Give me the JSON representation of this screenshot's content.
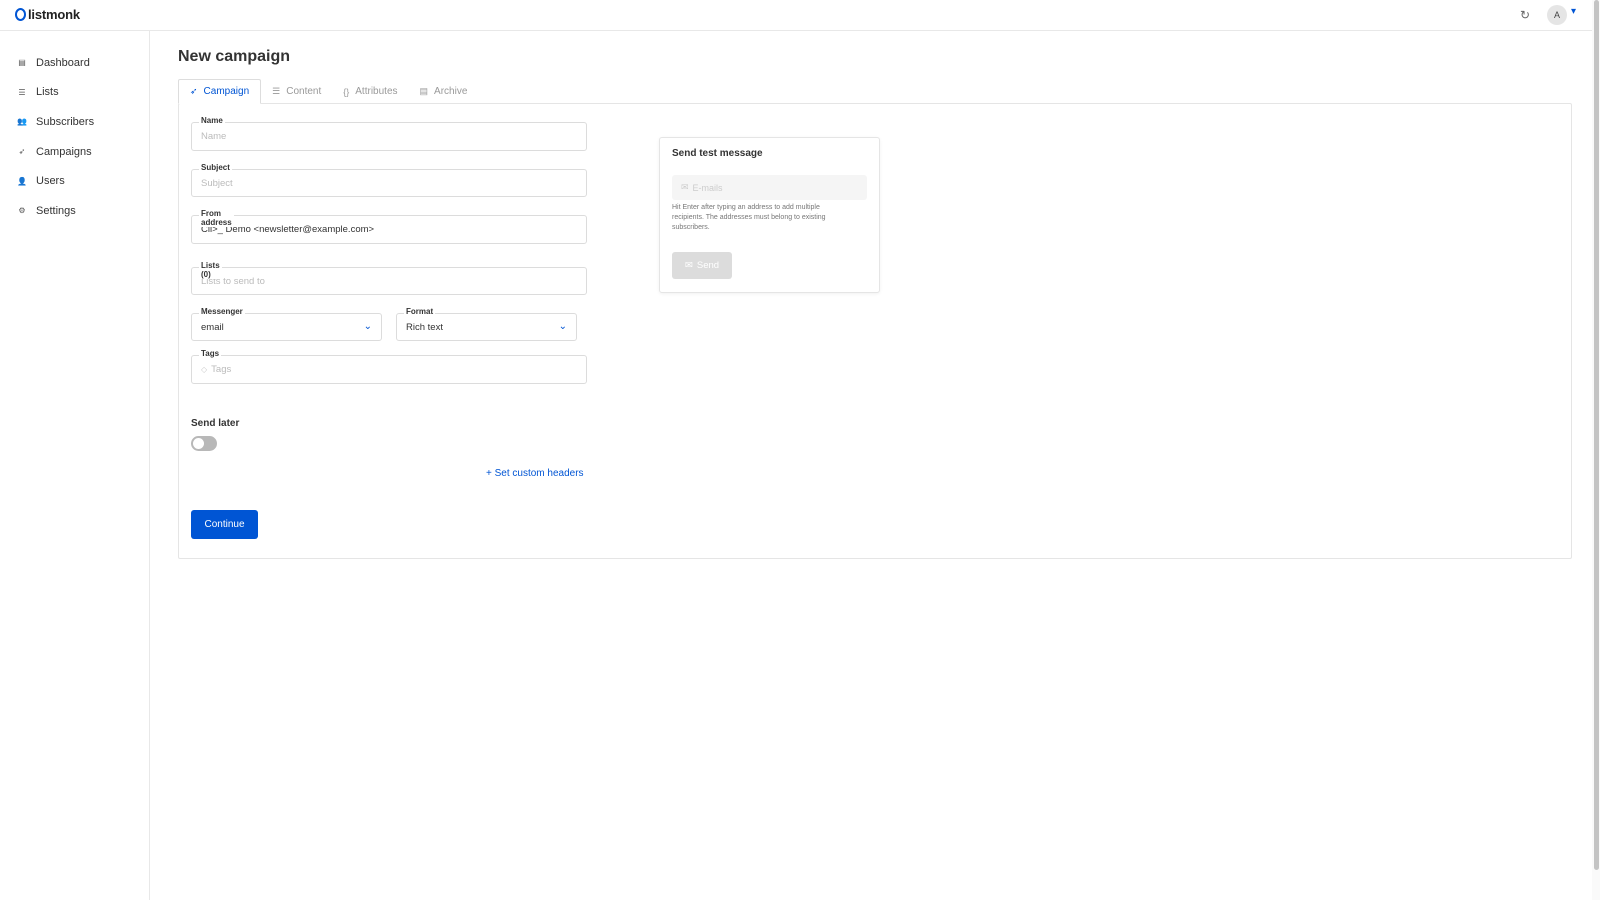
{
  "app": {
    "logo_text": "listmonk"
  },
  "header": {
    "avatar_initial": "A"
  },
  "sidebar": {
    "items": [
      {
        "label": "Dashboard",
        "icon": "dashboard-icon"
      },
      {
        "label": "Lists",
        "icon": "list-icon"
      },
      {
        "label": "Subscribers",
        "icon": "users-icon"
      },
      {
        "label": "Campaigns",
        "icon": "rocket-icon"
      },
      {
        "label": "Users",
        "icon": "user-icon"
      },
      {
        "label": "Settings",
        "icon": "gear-icon"
      }
    ]
  },
  "page": {
    "title": "New campaign"
  },
  "tabs": [
    {
      "label": "Campaign",
      "active": true
    },
    {
      "label": "Content",
      "active": false
    },
    {
      "label": "Attributes",
      "active": false
    },
    {
      "label": "Archive",
      "active": false
    }
  ],
  "form": {
    "name": {
      "label": "Name",
      "placeholder": "Name",
      "value": ""
    },
    "subject": {
      "label": "Subject",
      "placeholder": "Subject",
      "value": ""
    },
    "from_address": {
      "label": "From address",
      "value": "Cli>_ Demo <newsletter@example.com>"
    },
    "lists": {
      "label": "Lists (0)",
      "placeholder": "Lists to send to"
    },
    "messenger": {
      "label": "Messenger",
      "value": "email"
    },
    "format": {
      "label": "Format",
      "value": "Rich text"
    },
    "tags": {
      "label": "Tags",
      "placeholder": "Tags"
    },
    "send_later": {
      "label": "Send later",
      "enabled": false
    },
    "custom_headers_link": "+ Set custom headers",
    "continue_button": "Continue"
  },
  "test_message": {
    "title": "Send test message",
    "emails_placeholder": "E-mails",
    "help_text": "Hit Enter after typing an address to add multiple recipients. The addresses must belong to existing subscribers.",
    "send_button": "Send"
  },
  "colors": {
    "primary": "#0055d4",
    "border": "#dcdcdc",
    "muted": "#999999"
  }
}
